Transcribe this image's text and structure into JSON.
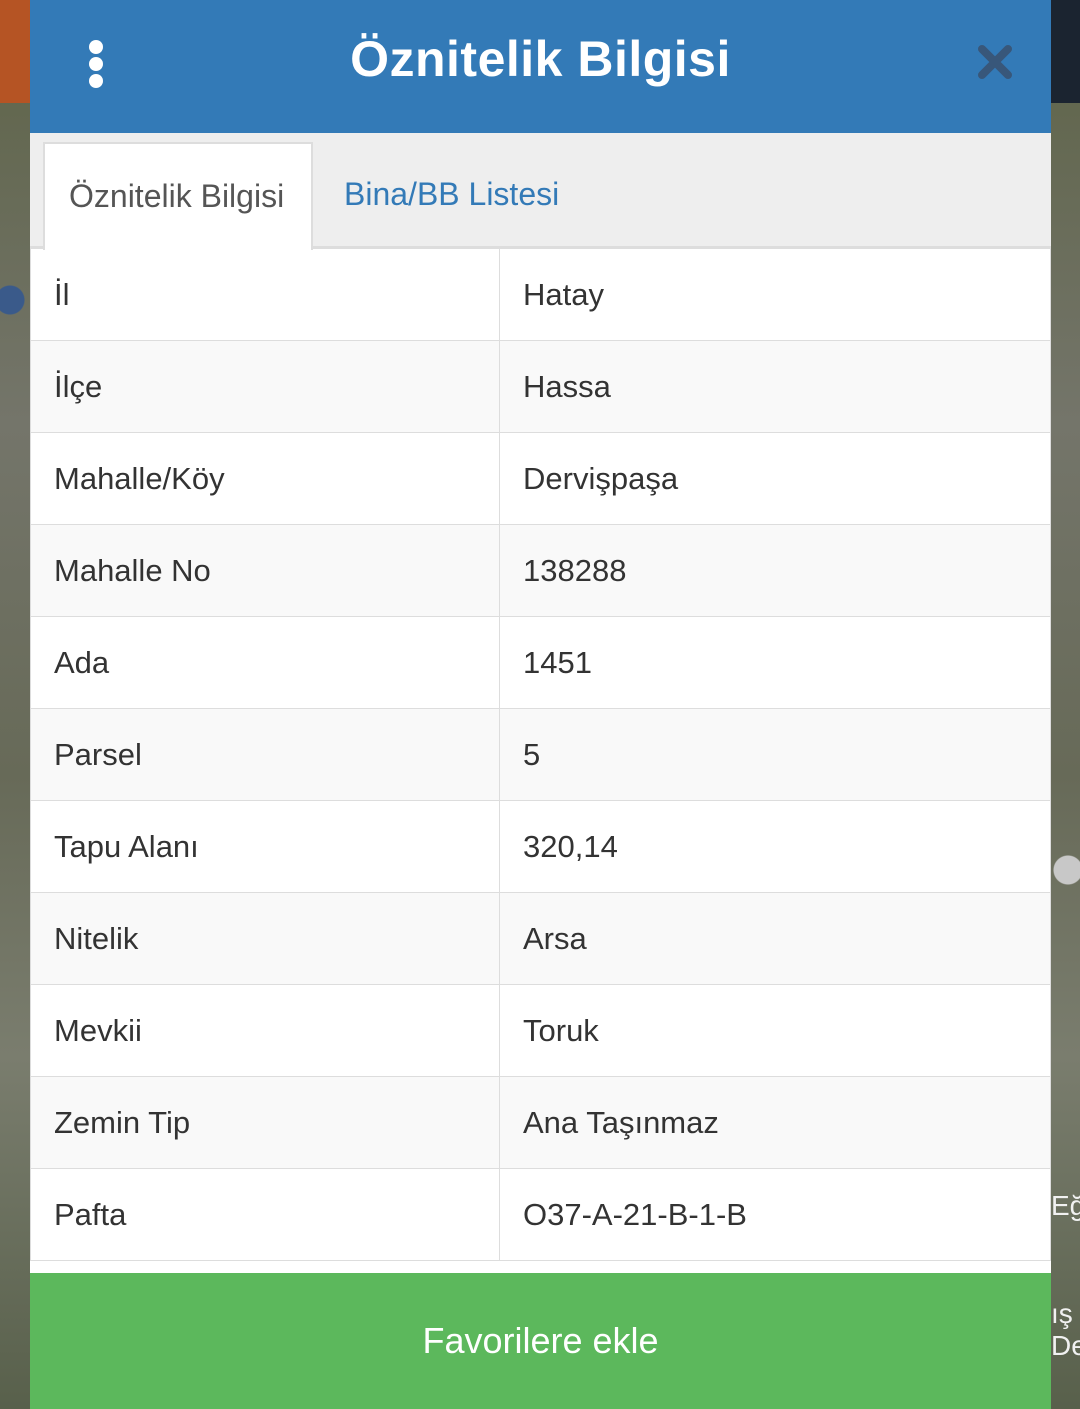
{
  "header": {
    "title": "Öznitelik Bilgisi"
  },
  "tabs": [
    {
      "label": "Öznitelik Bilgisi",
      "active": true
    },
    {
      "label": "Bina/BB Listesi",
      "active": false
    }
  ],
  "attributes": [
    {
      "key": "İl",
      "value": "Hatay"
    },
    {
      "key": "İlçe",
      "value": "Hassa"
    },
    {
      "key": "Mahalle/Köy",
      "value": "Dervişpaşa"
    },
    {
      "key": "Mahalle No",
      "value": "138288"
    },
    {
      "key": "Ada",
      "value": "1451"
    },
    {
      "key": "Parsel",
      "value": "5"
    },
    {
      "key": "Tapu Alanı",
      "value": "320,14"
    },
    {
      "key": "Nitelik",
      "value": "Arsa"
    },
    {
      "key": "Mevkii",
      "value": "Toruk"
    },
    {
      "key": "Zemin Tip",
      "value": "Ana Taşınmaz"
    },
    {
      "key": "Pafta",
      "value": "O37-A-21-B-1-B"
    }
  ],
  "footer": {
    "favorites_label": "Favorilere ekle"
  },
  "map_labels": {
    "right_1": "Eğ",
    "right_2": "ış",
    "right_3": "De"
  },
  "colors": {
    "header": "#337ab7",
    "button": "#5cb85c",
    "tab_link": "#337ab7"
  },
  "icons": {
    "menu": "vertical-dots-icon",
    "close": "close-icon"
  }
}
